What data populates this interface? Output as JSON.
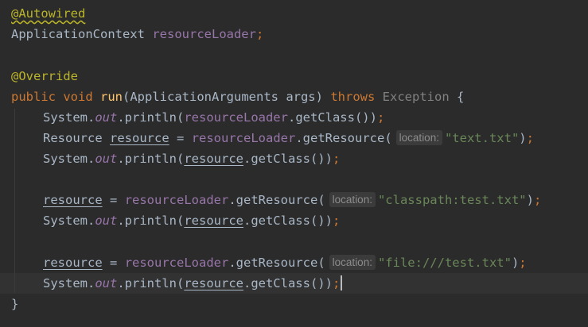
{
  "editor": {
    "l1": {
      "annotation": "@Autowired"
    },
    "l2": {
      "type": "ApplicationContext",
      "field": "resourceLoader",
      "semi": ";"
    },
    "l4": {
      "annotation": "@Override"
    },
    "l5": {
      "kw_public": "public",
      "kw_void": "void",
      "method": "run",
      "params": "(ApplicationArguments args)",
      "kw_throws": "throws",
      "exception": "Exception",
      "brace": "{"
    },
    "l6": {
      "system": "System.",
      "out": "out",
      "println": ".println(",
      "field": "resourceLoader",
      "rest": ".getClass())",
      "semi": ";"
    },
    "l7": {
      "type": "Resource",
      "var": "resource",
      "assign": "=",
      "field": "resourceLoader",
      "call": ".getResource(",
      "hint": "location:",
      "string": "\"text.txt\"",
      "close": ")",
      "semi": ";"
    },
    "l8": {
      "system": "System.",
      "out": "out",
      "println": ".println(",
      "var": "resource",
      "rest": ".getClass())",
      "semi": ";"
    },
    "l10": {
      "var": "resource",
      "assign": "=",
      "field": "resourceLoader",
      "call": ".getResource(",
      "hint": "location:",
      "string": "\"classpath:test.txt\"",
      "close": ")",
      "semi": ";"
    },
    "l11": {
      "system": "System.",
      "out": "out",
      "println": ".println(",
      "var": "resource",
      "rest": ".getClass())",
      "semi": ";"
    },
    "l13": {
      "var": "resource",
      "assign": "=",
      "field": "resourceLoader",
      "call": ".getResource(",
      "hint": "location:",
      "string": "\"file:///test.txt\"",
      "close": ")",
      "semi": ";"
    },
    "l14": {
      "system": "System.",
      "out": "out",
      "println": ".println(",
      "var": "resource",
      "rest": ".getClass())",
      "semi": ";"
    },
    "l15": {
      "brace": "}"
    }
  }
}
